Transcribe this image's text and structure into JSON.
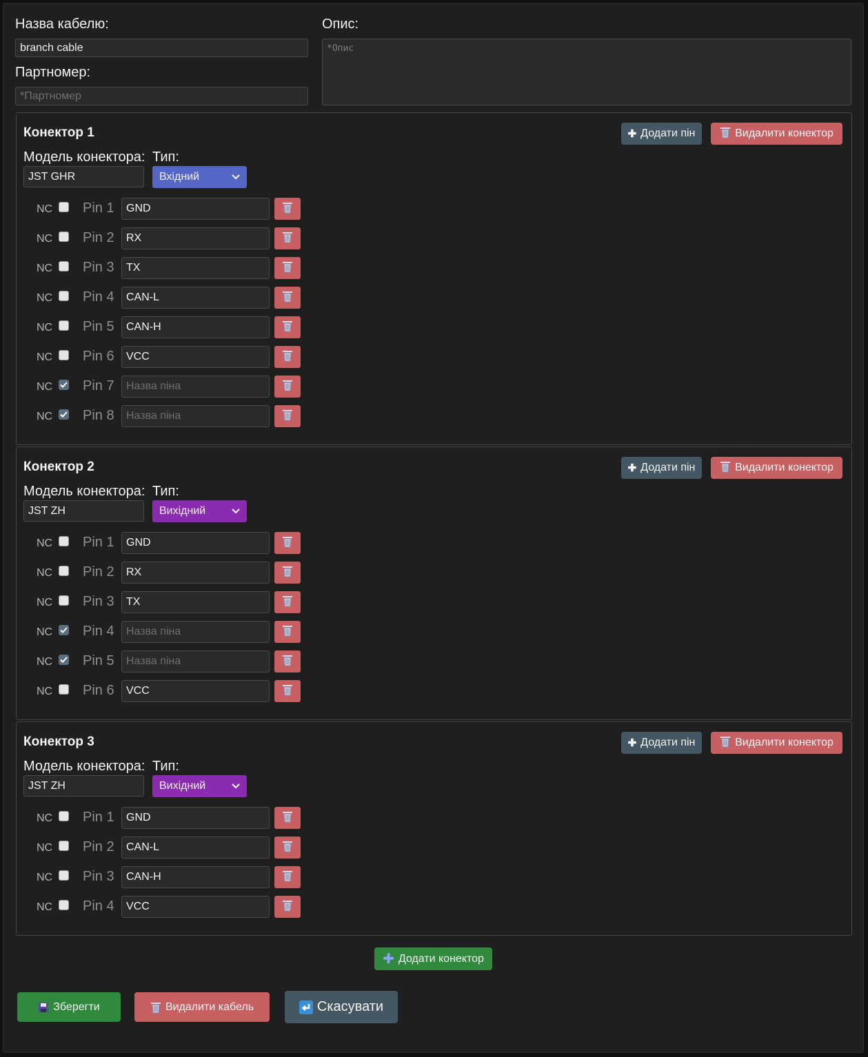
{
  "form": {
    "cable_name_label": "Назва кабелю:",
    "cable_name_value": "branch cable",
    "part_number_label": "Партномер:",
    "part_number_placeholder": "*Партномер",
    "description_label": "Опис:",
    "description_placeholder": "*Опис"
  },
  "connectors": [
    {
      "title": "Конектор 1",
      "add_pin_label": "Додати пін",
      "delete_connector_label": "Видалити конектор",
      "model_label": "Модель конектора:",
      "model_value": "JST GHR",
      "type_label": "Тип:",
      "type_value": "Вхідний",
      "pins": [
        {
          "nc_label": "NC",
          "nc_checked": false,
          "label": "Pin 1",
          "value": "GND",
          "placeholder": "Назва піна"
        },
        {
          "nc_label": "NC",
          "nc_checked": false,
          "label": "Pin 2",
          "value": "RX",
          "placeholder": "Назва піна"
        },
        {
          "nc_label": "NC",
          "nc_checked": false,
          "label": "Pin 3",
          "value": "TX",
          "placeholder": "Назва піна"
        },
        {
          "nc_label": "NC",
          "nc_checked": false,
          "label": "Pin 4",
          "value": "CAN-L",
          "placeholder": "Назва піна"
        },
        {
          "nc_label": "NC",
          "nc_checked": false,
          "label": "Pin 5",
          "value": "CAN-H",
          "placeholder": "Назва піна"
        },
        {
          "nc_label": "NC",
          "nc_checked": false,
          "label": "Pin 6",
          "value": "VCC",
          "placeholder": "Назва піна"
        },
        {
          "nc_label": "NC",
          "nc_checked": true,
          "label": "Pin 7",
          "value": "",
          "placeholder": "Назва піна"
        },
        {
          "nc_label": "NC",
          "nc_checked": true,
          "label": "Pin 8",
          "value": "",
          "placeholder": "Назва піна"
        }
      ]
    },
    {
      "title": "Конектор 2",
      "add_pin_label": "Додати пін",
      "delete_connector_label": "Видалити конектор",
      "model_label": "Модель конектора:",
      "model_value": "JST ZH",
      "type_label": "Тип:",
      "type_value": "Вихідний",
      "pins": [
        {
          "nc_label": "NC",
          "nc_checked": false,
          "label": "Pin 1",
          "value": "GND",
          "placeholder": "Назва піна"
        },
        {
          "nc_label": "NC",
          "nc_checked": false,
          "label": "Pin 2",
          "value": "RX",
          "placeholder": "Назва піна"
        },
        {
          "nc_label": "NC",
          "nc_checked": false,
          "label": "Pin 3",
          "value": "TX",
          "placeholder": "Назва піна"
        },
        {
          "nc_label": "NC",
          "nc_checked": true,
          "label": "Pin 4",
          "value": "",
          "placeholder": "Назва піна"
        },
        {
          "nc_label": "NC",
          "nc_checked": true,
          "label": "Pin 5",
          "value": "",
          "placeholder": "Назва піна"
        },
        {
          "nc_label": "NC",
          "nc_checked": false,
          "label": "Pin 6",
          "value": "VCC",
          "placeholder": "Назва піна"
        }
      ]
    },
    {
      "title": "Конектор 3",
      "add_pin_label": "Додати пін",
      "delete_connector_label": "Видалити конектор",
      "model_label": "Модель конектора:",
      "model_value": "JST ZH",
      "type_label": "Тип:",
      "type_value": "Вихідний",
      "pins": [
        {
          "nc_label": "NC",
          "nc_checked": false,
          "label": "Pin 1",
          "value": "GND",
          "placeholder": "Назва піна"
        },
        {
          "nc_label": "NC",
          "nc_checked": false,
          "label": "Pin 2",
          "value": "CAN-L",
          "placeholder": "Назва піна"
        },
        {
          "nc_label": "NC",
          "nc_checked": false,
          "label": "Pin 3",
          "value": "CAN-H",
          "placeholder": "Назва піна"
        },
        {
          "nc_label": "NC",
          "nc_checked": false,
          "label": "Pin 4",
          "value": "VCC",
          "placeholder": "Назва піна"
        }
      ]
    }
  ],
  "actions": {
    "add_connector_label": "Додати конектор",
    "save_label": "Зберегти",
    "delete_cable_label": "Видалити кабель",
    "cancel_label": "Скасувати"
  },
  "colors": {
    "background": "#1f1f1f",
    "add_pin_button": "#455763",
    "delete_button": "#c75f63",
    "add_connector_button": "#2f8a3d",
    "save_button": "#2f8a3d",
    "cancel_button": "#455763",
    "type_input": "#5666c4",
    "type_output": "#8a2bb0"
  }
}
